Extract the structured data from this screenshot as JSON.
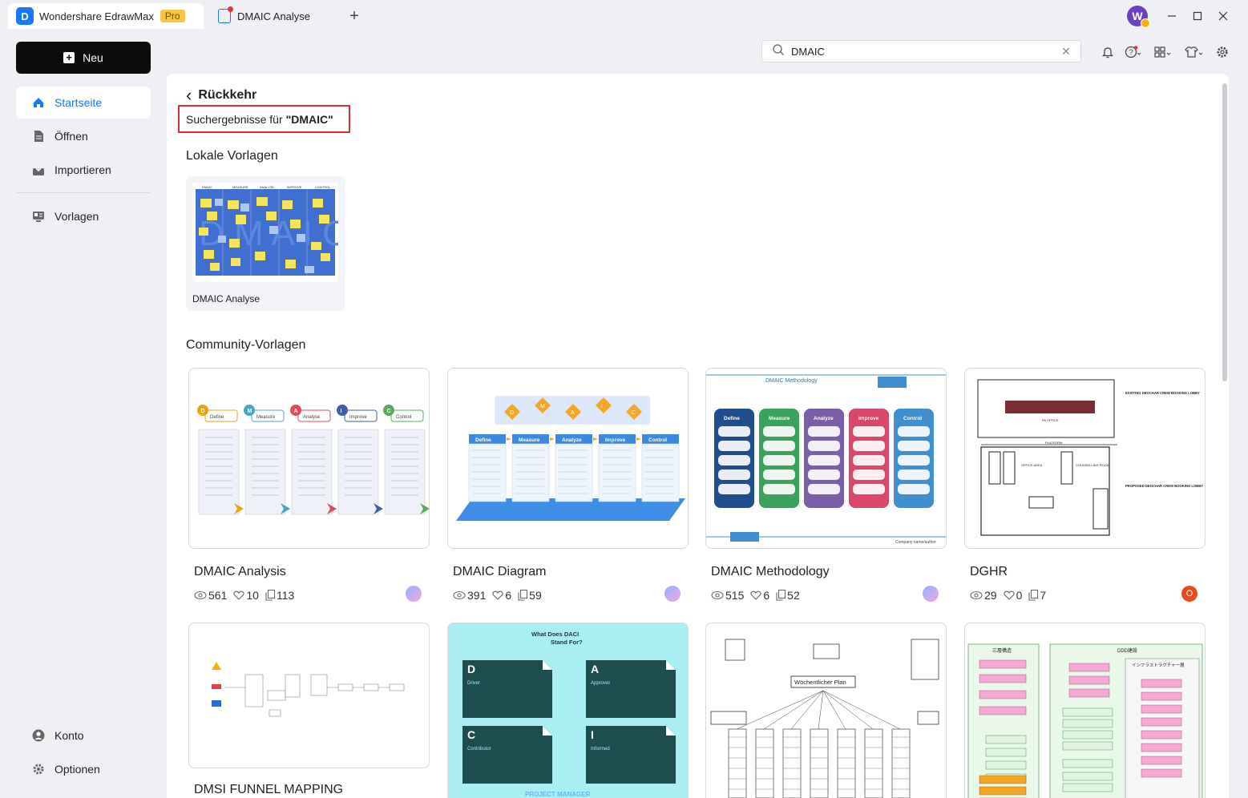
{
  "app": {
    "name": "Wondershare EdrawMax",
    "badge": "Pro",
    "logo_letter": "D",
    "user_initial": "W"
  },
  "tabs": [
    {
      "label": "DMAIC Analyse"
    }
  ],
  "sidebar": {
    "new_label": "Neu",
    "items": [
      {
        "label": "Startseite",
        "icon": "home-icon"
      },
      {
        "label": "Öffnen",
        "icon": "file-icon"
      },
      {
        "label": "Importieren",
        "icon": "import-icon"
      },
      {
        "label": "Vorlagen",
        "icon": "templates-icon"
      }
    ],
    "bottom": [
      {
        "label": "Konto",
        "icon": "account-icon"
      },
      {
        "label": "Optionen",
        "icon": "gear-icon"
      }
    ]
  },
  "search": {
    "value": "DMAIC"
  },
  "main": {
    "back_label": "Rückkehr",
    "results_prefix": "Suchergebnisse für",
    "results_query": "\"DMAIC\"",
    "local_title": "Lokale Vorlagen",
    "community_title": "Community-Vorlagen",
    "local_templates": [
      {
        "title": "DMAIC Analyse"
      }
    ],
    "community_templates": [
      {
        "title": "DMAIC Analysis",
        "views": "561",
        "likes": "10",
        "copies": "113"
      },
      {
        "title": "DMAIC Diagram",
        "views": "391",
        "likes": "6",
        "copies": "59"
      },
      {
        "title": "DMAIC Methodology",
        "views": "515",
        "likes": "6",
        "copies": "52"
      },
      {
        "title": "DGHR",
        "views": "29",
        "likes": "0",
        "copies": "7",
        "avatar_initial": "O"
      },
      {
        "title": "DMSI FUNNEL MAPPING"
      },
      {
        "title": ""
      },
      {
        "title": ""
      },
      {
        "title": ""
      }
    ]
  },
  "thumbs": {
    "analysis": {
      "letters": [
        "D",
        "M",
        "A",
        "I",
        "C"
      ],
      "headers": [
        "Define",
        "Measure",
        "Analyse",
        "Improve",
        "Control"
      ],
      "colors": [
        "#e8a317",
        "#4aa3c9",
        "#e0495b",
        "#3f5fa8",
        "#5bab5c"
      ]
    },
    "diagram": {
      "letters": [
        "D",
        "M",
        "A",
        "I",
        "C"
      ],
      "headers": [
        "Define",
        "Measure",
        "Analyze",
        "Improve",
        "Control"
      ]
    },
    "methodology": {
      "title": "DMAIC Methodology",
      "footer": "Company name/author",
      "headers": [
        "Define",
        "Measure",
        "Analyze",
        "Improve",
        "Control"
      ],
      "colors": [
        "#1f4e8c",
        "#3aa25a",
        "#7b5ea8",
        "#d9486a",
        "#3f8fcf"
      ]
    },
    "dghr": {
      "labels": [
        "EXISTING DEOCHAR CREW BOOKING LOBBY",
        "PROPOSED DEOCHAR CREW BOOKING LOBBY",
        "OFFICE AREA",
        "COUNSELLING ROOM",
        "PLATFORM"
      ]
    },
    "daci": {
      "title": "What Does DACI Stand For?",
      "cards": [
        {
          "letter": "D",
          "word": "Driver"
        },
        {
          "letter": "A",
          "word": "Approver"
        },
        {
          "letter": "C",
          "word": "Contributor"
        },
        {
          "letter": "I",
          "word": "Informed"
        }
      ],
      "footer": "PROJECT MANAGER"
    },
    "plan": {
      "title": "Wöchentlicher Plan"
    },
    "ddd": {
      "left_title": "三層構造",
      "right_title": "DDD建設",
      "infra": "インフラストラクチャー層"
    }
  },
  "colors": {
    "accent": "#1677ff",
    "highlight_border": "#d4303b"
  }
}
